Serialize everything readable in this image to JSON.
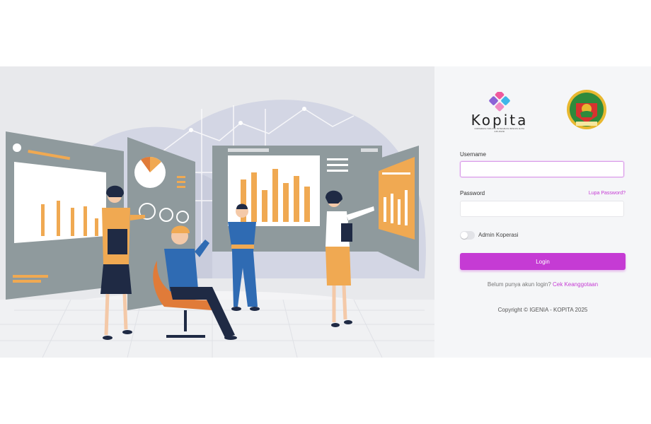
{
  "brand": {
    "name": "Kopita",
    "tagline": "KOPERASI SOLUSI INTEGRASI BISNIS DATA APLIKASI"
  },
  "form": {
    "username_label": "Username",
    "username_value": "",
    "password_label": "Password",
    "password_value": "",
    "forgot_label": "Lupa Password?",
    "admin_toggle_label": "Admin Koperasi",
    "admin_toggle_on": false,
    "login_label": "Login"
  },
  "signup": {
    "prompt": "Belum punya akun login?",
    "link": "Cek Keanggotaan"
  },
  "footer": {
    "copyright": "Copyright © IGENIA - KOPITA 2025"
  },
  "colors": {
    "accent": "#c53bd4",
    "panel_bg": "#f5f6f8",
    "illustration_bg": "#e8e9ec",
    "chart_orange": "#f0a952",
    "board_gray": "#8f9a9d"
  }
}
